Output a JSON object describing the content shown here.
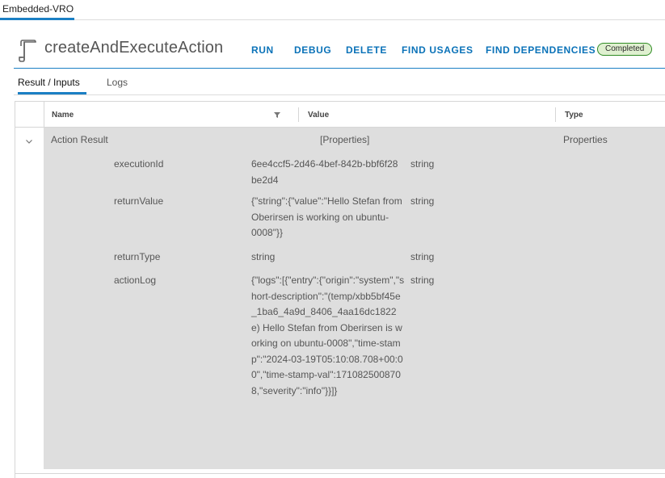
{
  "tabs": {
    "active_label": "Embedded-VRO"
  },
  "header": {
    "icon": "script-document-icon",
    "title": "createAndExecuteAction",
    "buttons": {
      "run": "RUN",
      "debug": "DEBUG",
      "delete": "DELETE",
      "find_usages": "FIND USAGES",
      "find_dependencies": "FIND DEPENDENCIES"
    },
    "status": "Completed"
  },
  "subtabs": {
    "result": "Result / Inputs",
    "logs": "Logs"
  },
  "grid": {
    "columns": {
      "name": "Name",
      "value": "Value",
      "type": "Type"
    },
    "parent_row": {
      "name": "Action Result",
      "value": "[Properties]",
      "type": "Properties"
    },
    "rows": [
      {
        "name": "executionId",
        "value": "6ee4ccf5-2d46-4bef-842b-bbf6f28be2d4",
        "type": "string"
      },
      {
        "name": "returnValue",
        "value": "{\"string\":{\"value\":\"Hello Stefan from Oberirsen is working on ubuntu-0008\"}}",
        "type": "string"
      },
      {
        "name": "returnType",
        "value": "string",
        "type": "string"
      },
      {
        "name": "actionLog",
        "value": "{\"logs\":[{\"entry\":{\"origin\":\"system\",\"short-description\":\"(temp/xbb5bf45e_1ba6_4a9d_8406_4aa16dc1822e) Hello Stefan from Oberirsen is working on ubuntu-0008\",\"time-stamp\":\"2024-03-19T05:10:08.708+00:00\",\"time-stamp-val\":1710825008708,\"severity\":\"info\"}}]}",
        "type": "string"
      }
    ]
  },
  "colors": {
    "accent": "#1b7fc4",
    "link": "#0a72b8",
    "badge_border": "#2f8b23",
    "badge_bg": "#dff0d0",
    "row_bg": "#dedede"
  }
}
